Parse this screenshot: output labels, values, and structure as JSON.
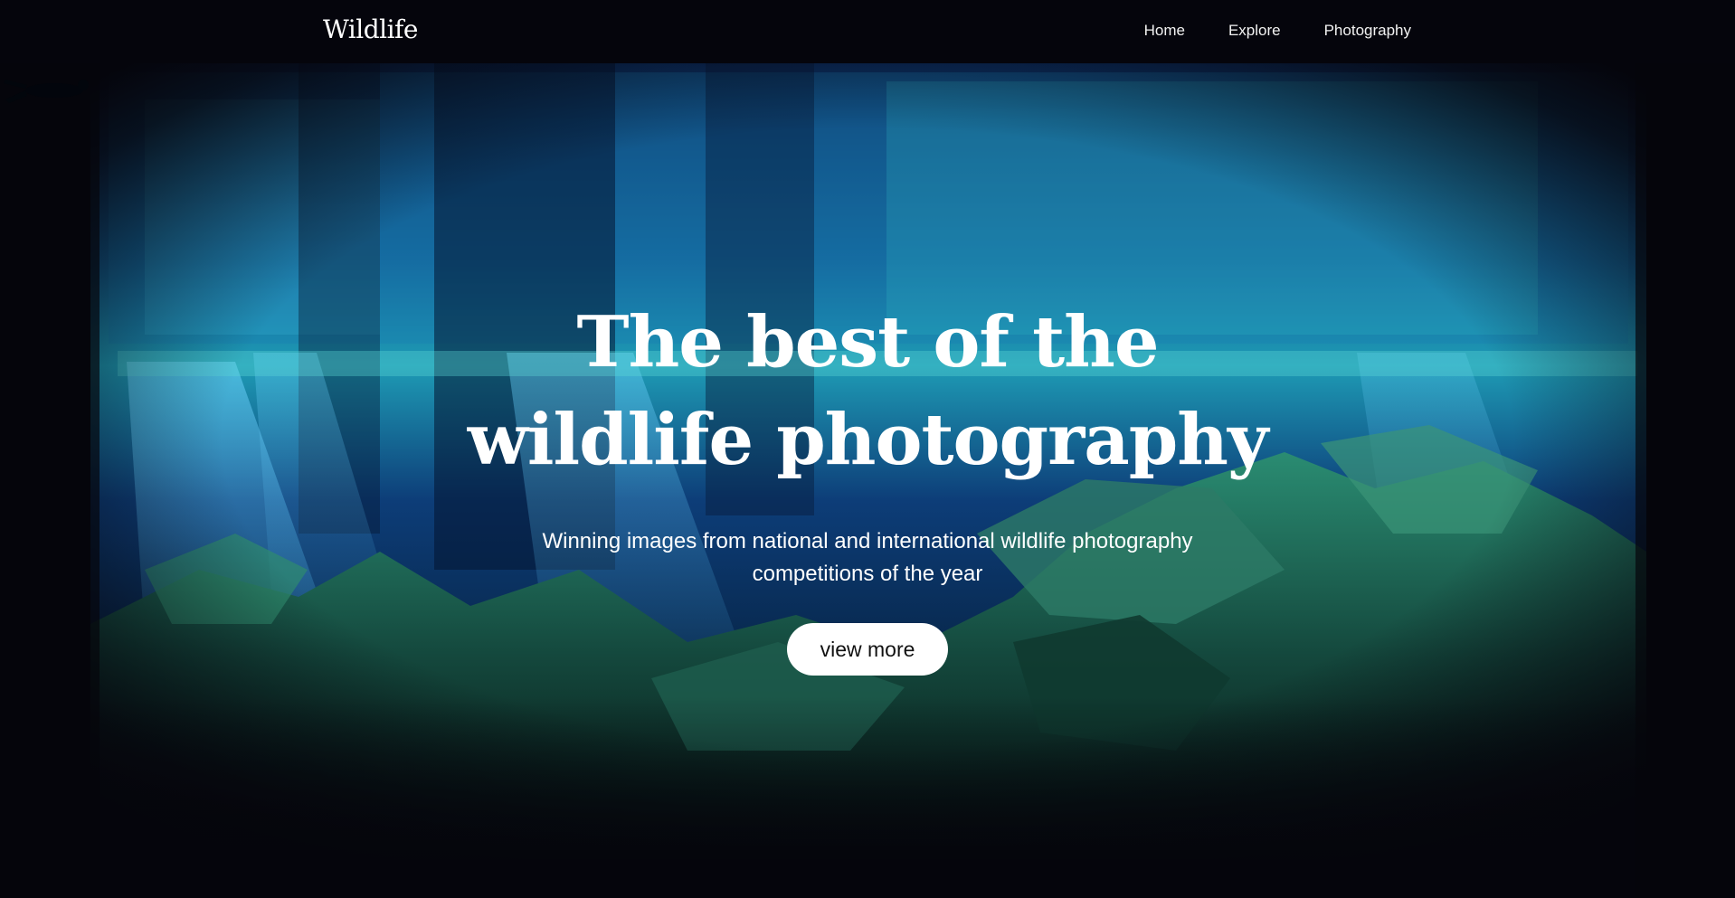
{
  "header": {
    "brand": "Wildlife",
    "nav": [
      {
        "label": "Home"
      },
      {
        "label": "Explore"
      },
      {
        "label": "Photography"
      }
    ]
  },
  "hero": {
    "title_line1": "The best of the",
    "title_line2": "wildlife photography",
    "subtitle": "Winning images from national and international wildlife photography competitions of the year",
    "button_label": "view more"
  },
  "colors": {
    "background": "#05050c",
    "water_deep": "#0a2a5c",
    "water_light": "#2bb6c9",
    "rock": "#1f6a5a",
    "button_bg": "#ffffff"
  }
}
